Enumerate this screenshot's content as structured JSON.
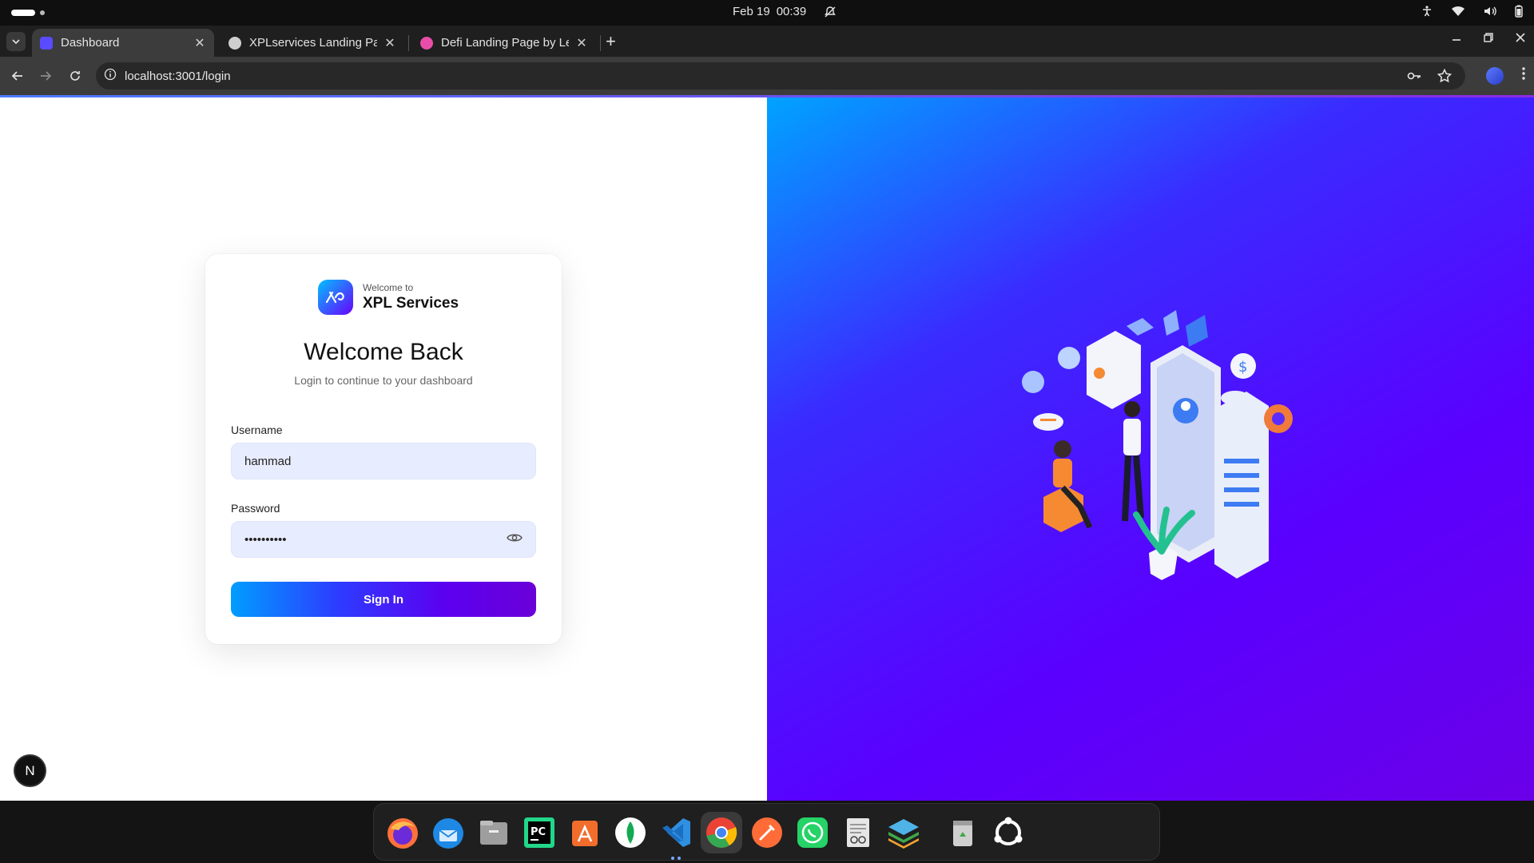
{
  "system_bar": {
    "date": "Feb 19",
    "time": "00:39"
  },
  "browser": {
    "tabs": [
      {
        "title": "Dashboard",
        "active": true,
        "favicon_color": "#5a4bff"
      },
      {
        "title": "XPLservices Landing Pag",
        "active": false,
        "favicon_color": "#cfcfcf"
      },
      {
        "title": "Defi Landing Page by Lev",
        "active": false,
        "favicon_color": "#e84ea8"
      }
    ],
    "url": "localhost:3001/login"
  },
  "login": {
    "brand_small": "Welcome to",
    "brand_name": "XPL Services",
    "logo_mark": "✖",
    "heading": "Welcome Back",
    "subheading": "Login to continue to your dashboard",
    "username_label": "Username",
    "username_value": "hammad",
    "password_label": "Password",
    "password_value": "••••••••••",
    "signin_label": "Sign In"
  },
  "dev_badge": "N",
  "dock": [
    {
      "name": "firefox",
      "color": "#ff7139"
    },
    {
      "name": "thunderbird",
      "color": "#1e88e5"
    },
    {
      "name": "files",
      "color": "#9e9e9e"
    },
    {
      "name": "pycharm",
      "color": "#21d789"
    },
    {
      "name": "app-center",
      "color": "#f26c2b"
    },
    {
      "name": "mongodb-compass",
      "color": "#ffffff"
    },
    {
      "name": "vscode",
      "color": "#2f8fe0"
    },
    {
      "name": "chrome",
      "color": "#ea4335"
    },
    {
      "name": "postman",
      "color": "#ff6c37"
    },
    {
      "name": "whatsapp",
      "color": "#25d366"
    },
    {
      "name": "text-editor",
      "color": "#e6e6e6"
    },
    {
      "name": "layers-app",
      "color": "#3ea84a"
    },
    {
      "name": "trash",
      "color": "#cfcfcf"
    },
    {
      "name": "ubuntu-apps",
      "color": "#ffffff"
    }
  ]
}
